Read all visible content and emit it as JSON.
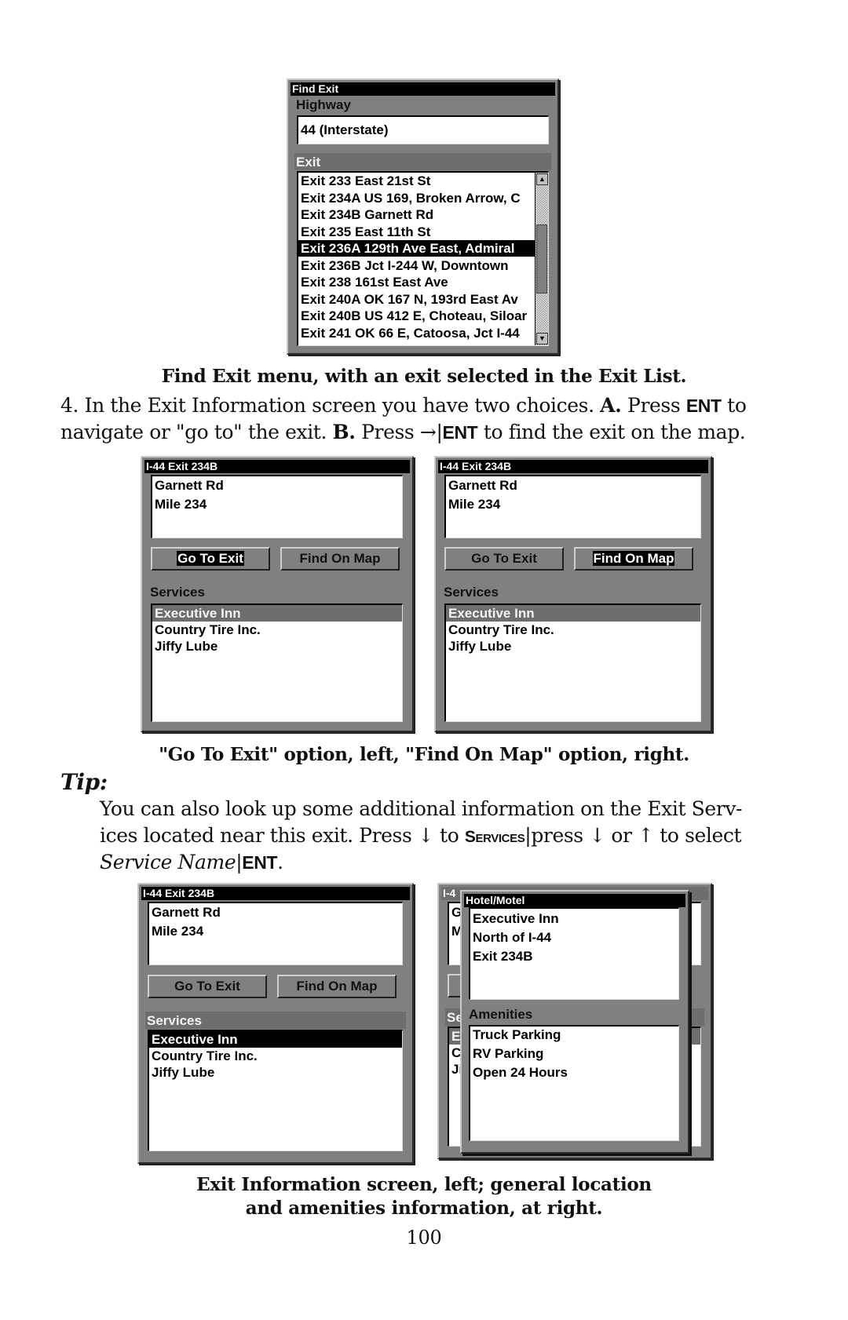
{
  "figure1": {
    "screen": {
      "title": "Find Exit",
      "highway_label": "Highway",
      "highway_value": "44 (Interstate)",
      "exit_label": "Exit",
      "exits": [
        "Exit 233 East 21st St",
        "Exit 234A US 169, Broken Arrow, C",
        "Exit 234B Garnett Rd",
        "Exit 235 East 11th St",
        "Exit 236A 129th Ave East, Admiral",
        "Exit 236B Jct I-244 W, Downtown",
        "Exit 238 161st East Ave",
        "Exit 240A OK 167 N, 193rd East Av",
        "Exit 240B US 412 E, Choteau, Siloar",
        "Exit 241 OK 66 E, Catoosa, Jct I-44"
      ],
      "selected_index": 4,
      "scroll_up_icon": "▲",
      "scroll_down_icon": "▼"
    },
    "caption": "Find Exit menu, with an exit selected in the Exit List."
  },
  "step4": {
    "number": "4.",
    "line1_a": "In the Exit Information screen you have two choices. ",
    "choice_a": "A.",
    "line1_b": " Press ",
    "key_ent": "ENT",
    "line1_c": " to",
    "line2_a": "navigate or \"go to\" the exit. ",
    "choice_b": "B.",
    "line2_b": " Press ",
    "arrow_right": "→",
    "separator": "|",
    "line2_c": " to find the exit on the map."
  },
  "figure2": {
    "screens": [
      {
        "title": "I-44 Exit 234B",
        "info_lines": [
          "Garnett Rd",
          "Mile 234"
        ],
        "go_to_exit": "Go To Exit",
        "find_on_map": "Find On Map",
        "focused_button": "go_to_exit",
        "services_label": "Services",
        "services": [
          "Executive Inn",
          "Country Tire Inc.",
          "Jiffy Lube"
        ]
      },
      {
        "title": "I-44 Exit 234B",
        "info_lines": [
          "Garnett Rd",
          "Mile 234"
        ],
        "go_to_exit": "Go To Exit",
        "find_on_map": "Find On Map",
        "focused_button": "find_on_map",
        "services_label": "Services",
        "services": [
          "Executive Inn",
          "Country Tire Inc.",
          "Jiffy Lube"
        ]
      }
    ],
    "caption": "\"Go To Exit\" option, left, \"Find On Map\" option, right."
  },
  "tip": {
    "heading": "Tip:",
    "line1": "You can also look up some additional information on the Exit Serv-",
    "line2_a": "ices located near this exit. Press ",
    "arrow_down": "↓",
    "line2_b": " to ",
    "key_services": "Services",
    "separator": "|",
    "line2_c": "press ",
    "line2_d": " or ",
    "arrow_up": "↑",
    "line2_e": " to select",
    "service_name": "Service Name",
    "key_ent": "ENT",
    "period": "."
  },
  "figure3": {
    "left": {
      "title": "I-44 Exit 234B",
      "info_lines": [
        "Garnett Rd",
        "Mile 234"
      ],
      "go_to_exit": "Go To Exit",
      "find_on_map": "Find On Map",
      "services_label": "Services",
      "services": [
        "Executive Inn",
        "Country Tire Inc.",
        "Jiffy Lube"
      ]
    },
    "right": {
      "bg_title_fragment": "I-4",
      "bg_info_fragments": [
        "G",
        "M"
      ],
      "bg_services_fragment": "Se",
      "bg_service_fragments": [
        "E",
        "C",
        "Ji"
      ],
      "popup_title": "Hotel/Motel",
      "popup_info_lines": [
        "Executive Inn",
        "North of I-44",
        "Exit 234B"
      ],
      "amenities_label": "Amenities",
      "amenities": [
        "Truck Parking",
        "RV Parking",
        "Open 24 Hours"
      ]
    },
    "caption_line1": "Exit Information screen, left; general location",
    "caption_line2": "and amenities information, at right."
  },
  "page_number": "100"
}
